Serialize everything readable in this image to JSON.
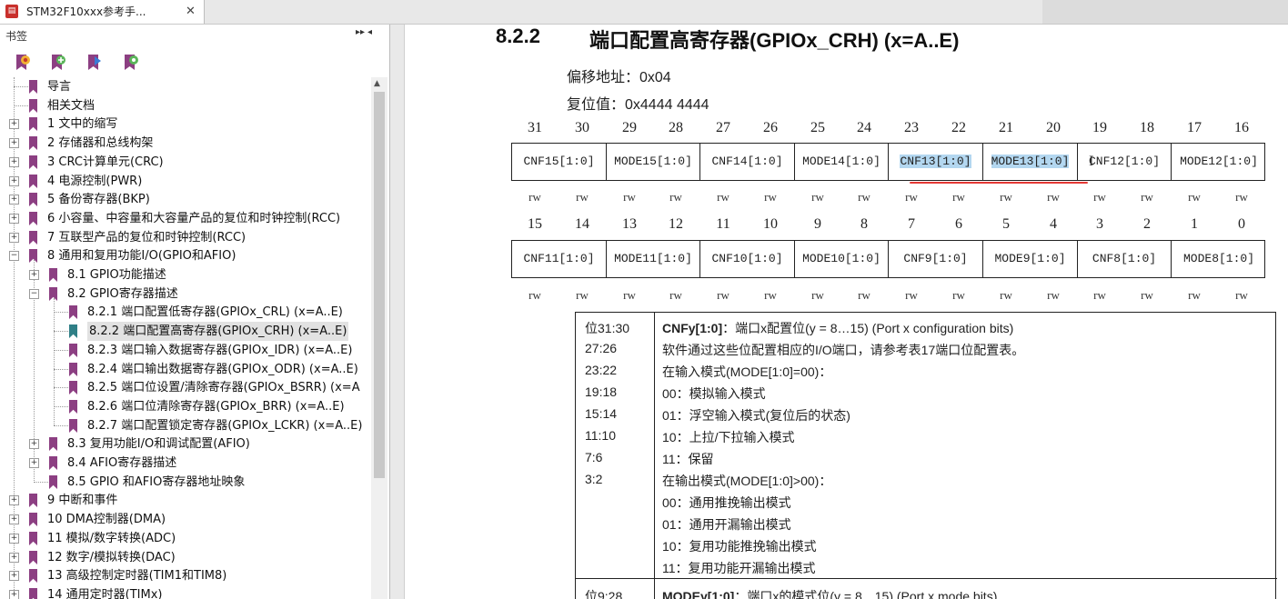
{
  "tab": {
    "icon": "pdf-icon",
    "title": "STM32F10xxx参考手...",
    "close": "✕"
  },
  "sidebar": {
    "title": "书签",
    "controls": [
      "▸▸",
      "▾",
      "◂"
    ],
    "tools": [
      "bookmark-delete-icon",
      "bookmark-add-icon",
      "bookmark-expand-icon",
      "bookmark-find-icon"
    ],
    "items": [
      {
        "label": "导言",
        "level": 0,
        "expander": ""
      },
      {
        "label": "相关文档",
        "level": 0,
        "expander": ""
      },
      {
        "label": "1 文中的缩写",
        "level": 0,
        "expander": "+"
      },
      {
        "label": "2 存储器和总线构架",
        "level": 0,
        "expander": "+"
      },
      {
        "label": "3 CRC计算单元(CRC)",
        "level": 0,
        "expander": "+"
      },
      {
        "label": "4 电源控制(PWR)",
        "level": 0,
        "expander": "+"
      },
      {
        "label": "5 备份寄存器(BKP)",
        "level": 0,
        "expander": "+"
      },
      {
        "label": "6 小容量、中容量和大容量产品的复位和时钟控制(RCC)",
        "level": 0,
        "expander": "+"
      },
      {
        "label": "7 互联型产品的复位和时钟控制(RCC)",
        "level": 0,
        "expander": "+"
      },
      {
        "label": "8 通用和复用功能I/O(GPIO和AFIO)",
        "level": 0,
        "expander": "−"
      },
      {
        "label": "8.1 GPIO功能描述",
        "level": 1,
        "expander": "+"
      },
      {
        "label": "8.2 GPIO寄存器描述",
        "level": 1,
        "expander": "−"
      },
      {
        "label": "8.2.1 端口配置低寄存器(GPIOx_CRL) (x=A..E)",
        "level": 2,
        "expander": ""
      },
      {
        "label": "8.2.2 端口配置高寄存器(GPIOx_CRH) (x=A..E)",
        "level": 2,
        "expander": "",
        "selected": true
      },
      {
        "label": "8.2.3 端口输入数据寄存器(GPIOx_IDR) (x=A..E)",
        "level": 2,
        "expander": ""
      },
      {
        "label": "8.2.4 端口输出数据寄存器(GPIOx_ODR) (x=A..E)",
        "level": 2,
        "expander": ""
      },
      {
        "label": "8.2.5 端口位设置/清除寄存器(GPIOx_BSRR) (x=A",
        "level": 2,
        "expander": ""
      },
      {
        "label": "8.2.6 端口位清除寄存器(GPIOx_BRR) (x=A..E)",
        "level": 2,
        "expander": ""
      },
      {
        "label": "8.2.7 端口配置锁定寄存器(GPIOx_LCKR) (x=A..E)",
        "level": 2,
        "expander": ""
      },
      {
        "label": "8.3 复用功能I/O和调试配置(AFIO)",
        "level": 1,
        "expander": "+"
      },
      {
        "label": "8.4 AFIO寄存器描述",
        "level": 1,
        "expander": "+"
      },
      {
        "label": "8.5 GPIO 和AFIO寄存器地址映象",
        "level": 1,
        "expander": ""
      },
      {
        "label": "9 中断和事件",
        "level": 0,
        "expander": "+"
      },
      {
        "label": "10 DMA控制器(DMA)",
        "level": 0,
        "expander": "+"
      },
      {
        "label": "11 模拟/数字转换(ADC)",
        "level": 0,
        "expander": "+"
      },
      {
        "label": "12 数字/模拟转换(DAC)",
        "level": 0,
        "expander": "+"
      },
      {
        "label": "13 高级控制定时器(TIM1和TIM8)",
        "level": 0,
        "expander": "+"
      },
      {
        "label": "14 通用定时器(TIMx)",
        "level": 0,
        "expander": "+"
      }
    ]
  },
  "doc": {
    "section_number": "8.2.2",
    "section_title": "端口配置高寄存器(GPIOx_CRH) (x=A..E)",
    "offset": "偏移地址：0x04",
    "reset": "复位值：0x4444 4444",
    "bits_high": [
      "31",
      "30",
      "29",
      "28",
      "27",
      "26",
      "25",
      "24",
      "23",
      "22",
      "21",
      "20",
      "19",
      "18",
      "17",
      "16"
    ],
    "bits_low": [
      "15",
      "14",
      "13",
      "12",
      "11",
      "10",
      "9",
      "8",
      "7",
      "6",
      "5",
      "4",
      "3",
      "2",
      "1",
      "0"
    ],
    "fields_high": [
      "CNF15[1:0]",
      "MODE15[1:0]",
      "CNF14[1:0]",
      "MODE14[1:0]",
      "CNF13[1:0]",
      "MODE13[1:0]",
      "CNF12[1:0]",
      "MODE12[1:0]"
    ],
    "fields_low": [
      "CNF11[1:0]",
      "MODE11[1:0]",
      "CNF10[1:0]",
      "MODE10[1:0]",
      "CNF9[1:0]",
      "MODE9[1:0]",
      "CNF8[1:0]",
      "MODE8[1:0]"
    ],
    "access": "rw",
    "desc": {
      "bitpos_label": "位31:30",
      "bitpos": [
        "27:26",
        "23:22",
        "19:18",
        "15:14",
        "11:10",
        "7:6",
        "3:2"
      ],
      "field_title": "CNFy[1:0]",
      "field_title_rest": "：端口x配置位(y = 8…15) (Port x configuration bits)",
      "lines": [
        "软件通过这些位配置相应的I/O端口，请参考表17端口位配置表。",
        "在输入模式(MODE[1:0]=00)：",
        "00：模拟输入模式",
        "01：浮空输入模式(复位后的状态)",
        "10：上拉/下拉输入模式",
        "11：保留",
        "在输出模式(MODE[1:0]>00)：",
        "00：通用推挽输出模式",
        "01：通用开漏输出模式",
        "10：复用功能推挽输出模式",
        "11：复用功能开漏输出模式"
      ],
      "next_bitpos": "位9:28",
      "next_title": "MODEy[1:0]",
      "next_title_rest": "：端口x的模式位(y = 8…15) (Port x mode bits)"
    }
  }
}
